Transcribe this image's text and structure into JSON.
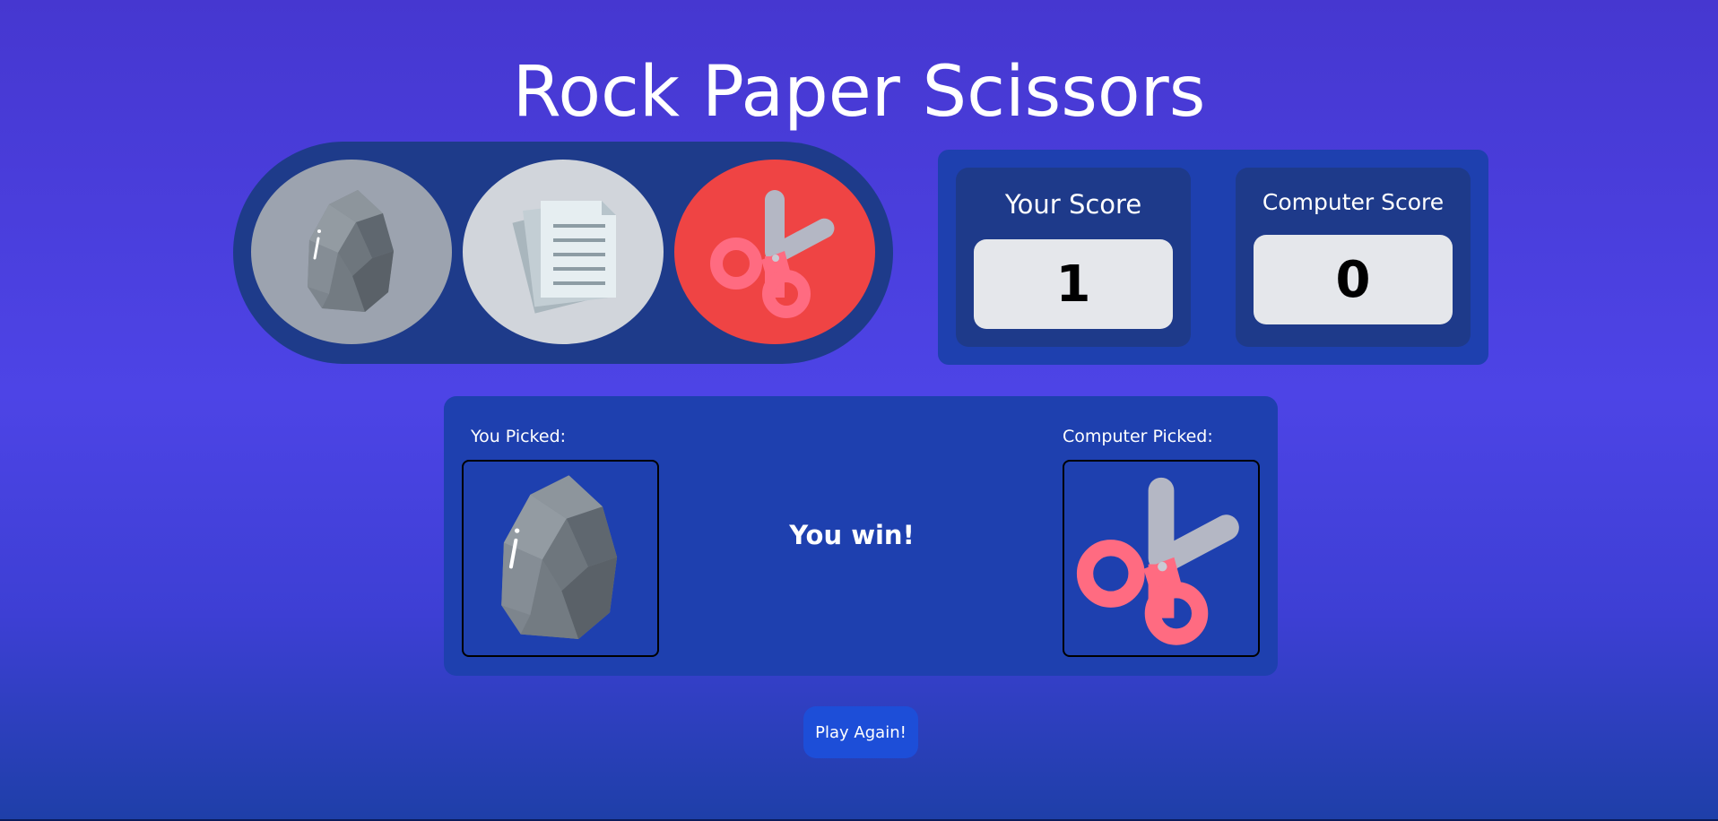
{
  "title": "Rock Paper Scissors",
  "choices": [
    {
      "id": "rock",
      "icon": "rock-icon"
    },
    {
      "id": "paper",
      "icon": "paper-icon"
    },
    {
      "id": "scissors",
      "icon": "scissors-icon"
    }
  ],
  "scores": {
    "you_label": "Your Score",
    "you_value": "1",
    "computer_label": "Computer Score",
    "computer_value": "0"
  },
  "result": {
    "you_picked_label": "You Picked:",
    "you_picked": "rock",
    "computer_picked_label": "Computer Picked:",
    "computer_picked": "scissors",
    "message": "You win!"
  },
  "play_again_label": "Play Again!",
  "colors": {
    "rock_button": "#9ca3af",
    "paper_button": "#d1d5db",
    "scissors_button": "#ef4444",
    "panel": "#1e40af",
    "panel_dark": "#1e3a8a"
  }
}
